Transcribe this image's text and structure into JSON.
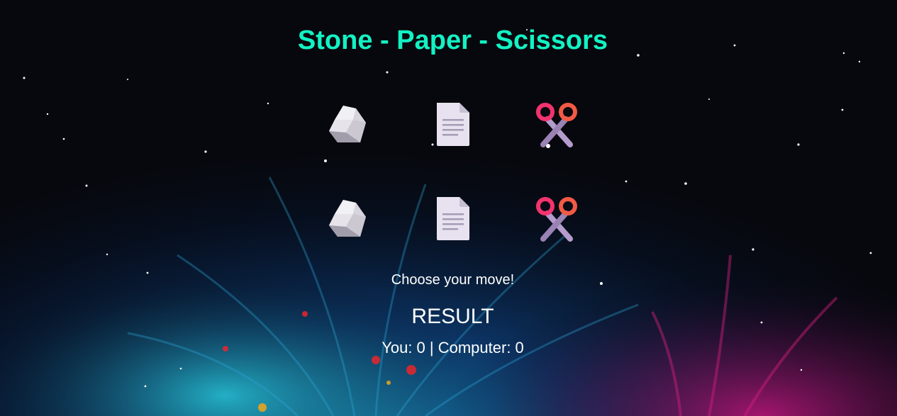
{
  "page": {
    "title": "Stone - Paper - Scissors",
    "title_color": "#13f2c4",
    "background": "dark space with blue, teal and magenta paint splash"
  },
  "player_moves": [
    {
      "name": "stone",
      "icon": "rock-icon"
    },
    {
      "name": "paper",
      "icon": "document-icon"
    },
    {
      "name": "scissors",
      "icon": "scissors-icon"
    }
  ],
  "computer_moves": [
    {
      "name": "stone",
      "icon": "rock-icon"
    },
    {
      "name": "paper",
      "icon": "document-icon"
    },
    {
      "name": "scissors",
      "icon": "scissors-icon"
    }
  ],
  "status": {
    "prompt": "Choose your move!",
    "result_heading": "RESULT",
    "score_text": "You: 0 | Computer: 0"
  }
}
